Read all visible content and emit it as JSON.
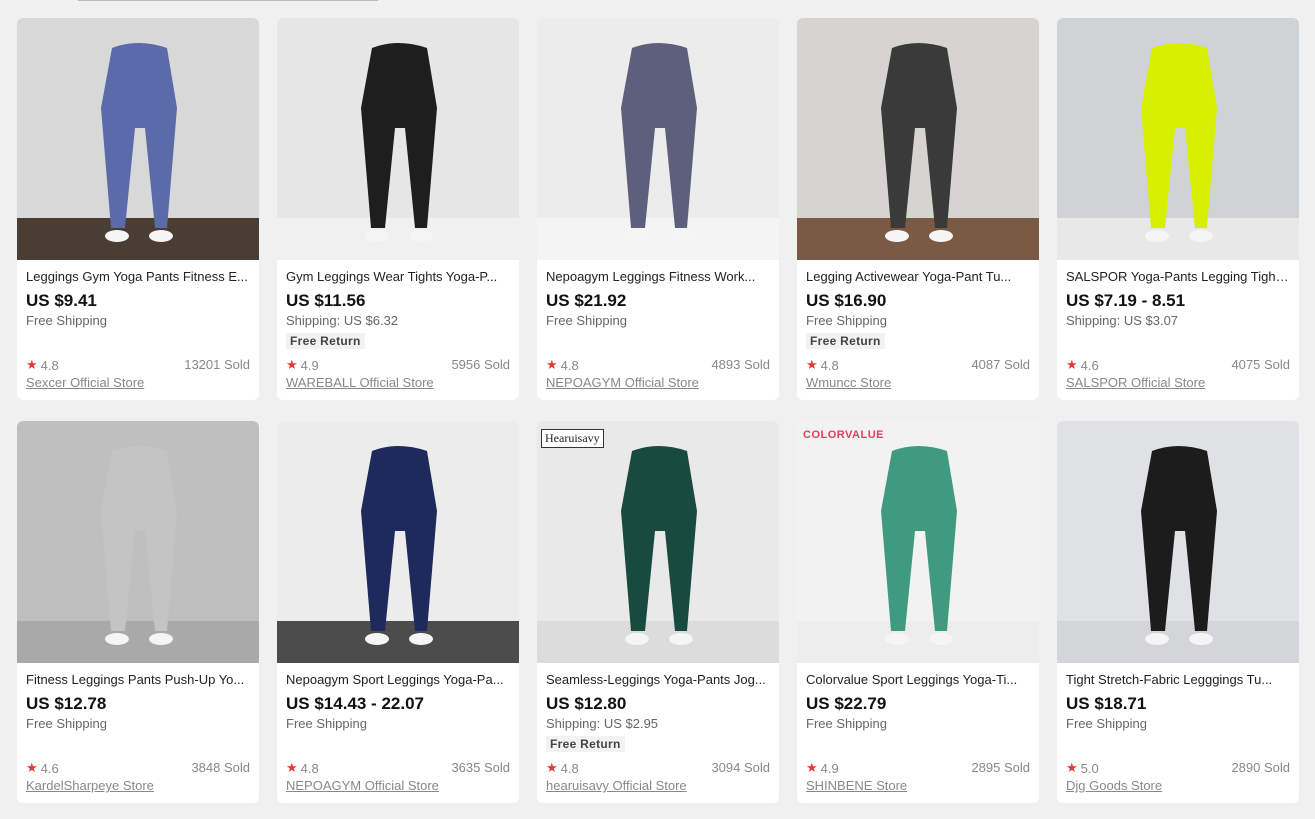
{
  "products": [
    {
      "title": "Leggings Gym Yoga Pants Fitness E...",
      "price": "US $9.41",
      "shipping": "Free Shipping",
      "free_return": "",
      "rating": "4.8",
      "sold": "13201 Sold",
      "store": "Sexcer Official Store",
      "image_desc": "blue-leggings-photo",
      "colors": {
        "bg": "#d8d8d8",
        "floor": "#4a3d33",
        "garment": "#5b6aa8"
      }
    },
    {
      "title": "Gym Leggings Wear Tights Yoga-P...",
      "price": "US $11.56",
      "shipping": "Shipping: US $6.32",
      "free_return": "Free Return",
      "rating": "4.9",
      "sold": "5956 Sold",
      "store": "WAREBALL Official Store",
      "image_desc": "black-leggings-photo",
      "colors": {
        "bg": "#e6e6e6",
        "floor": "#f0f0f0",
        "garment": "#1e1e1e"
      }
    },
    {
      "title": "Nepoagym Leggings Fitness Work...",
      "price": "US $21.92",
      "shipping": "Free Shipping",
      "free_return": "",
      "rating": "4.8",
      "sold": "4893 Sold",
      "store": "NEPOAGYM Official Store",
      "image_desc": "slate-leggings-photo",
      "colors": {
        "bg": "#ececec",
        "floor": "#f4f4f4",
        "garment": "#5e5f7d"
      }
    },
    {
      "title": "Legging Activewear Yoga-Pant Tu...",
      "price": "US $16.90",
      "shipping": "Free Shipping",
      "free_return": "Free Return",
      "rating": "4.8",
      "sold": "4087 Sold",
      "store": "Wmuncc Store",
      "image_desc": "grey-leggings-photo",
      "colors": {
        "bg": "#d6d4d0",
        "floor": "#7a5a44",
        "garment": "#3a3a3a"
      }
    },
    {
      "title": "SALSPOR Yoga-Pants Legging Tight...",
      "price": "US $7.19 - 8.51",
      "shipping": "Shipping: US $3.07",
      "free_return": "",
      "rating": "4.6",
      "sold": "4075 Sold",
      "store": "SALSPOR Official Store",
      "image_desc": "neon-leggings-photo",
      "colors": {
        "bg": "#cfd3d6",
        "floor": "#e8e8e8",
        "garment": "#d8f000"
      }
    },
    {
      "title": "Fitness Leggings Pants Push-Up Yo...",
      "price": "US $12.78",
      "shipping": "Free Shipping",
      "free_return": "",
      "rating": "4.6",
      "sold": "3848 Sold",
      "store": "KardelSharpeye Store",
      "image_desc": "light-grey-leggings-photo",
      "colors": {
        "bg": "#bfbfbf",
        "floor": "#a9a9a9",
        "garment": "#c4c4c4"
      }
    },
    {
      "title": "Nepoagym Sport Leggings Yoga-Pa...",
      "price": "US $14.43 - 22.07",
      "shipping": "Free Shipping",
      "free_return": "",
      "rating": "4.8",
      "sold": "3635 Sold",
      "store": "NEPOAGYM Official Store",
      "image_desc": "navy-leggings-photo",
      "colors": {
        "bg": "#ececec",
        "floor": "#4c4c4c",
        "garment": "#1f2a5c"
      }
    },
    {
      "title": "Seamless-Leggings Yoga-Pants Jog...",
      "price": "US $12.80",
      "shipping": "Shipping: US $2.95",
      "free_return": "Free Return",
      "rating": "4.8",
      "sold": "3094 Sold",
      "store": "hearuisavy Official Store",
      "image_desc": "green-leggings-photo",
      "overlay": "Hearuisavy",
      "colors": {
        "bg": "#e9e9e9",
        "floor": "#dcdcdc",
        "garment": "#184a40"
      }
    },
    {
      "title": "Colorvalue Sport Leggings Yoga-Ti...",
      "price": "US $22.79",
      "shipping": "Free Shipping",
      "free_return": "",
      "rating": "4.9",
      "sold": "2895 Sold",
      "store": "SHINBENE Store",
      "image_desc": "teal-leggings-photo",
      "overlay": "COLORVALUE",
      "colors": {
        "bg": "#f2f2f2",
        "floor": "#ededed",
        "garment": "#3f9a7e"
      }
    },
    {
      "title": "Tight Stretch-Fabric Legggings Tu...",
      "price": "US $18.71",
      "shipping": "Free Shipping",
      "free_return": "",
      "rating": "5.0",
      "sold": "2890 Sold",
      "store": "Djg Goods Store",
      "image_desc": "black-leggings-photo",
      "colors": {
        "bg": "#e0e1e4",
        "floor": "#d4d5d8",
        "garment": "#1c1c1c"
      }
    }
  ]
}
